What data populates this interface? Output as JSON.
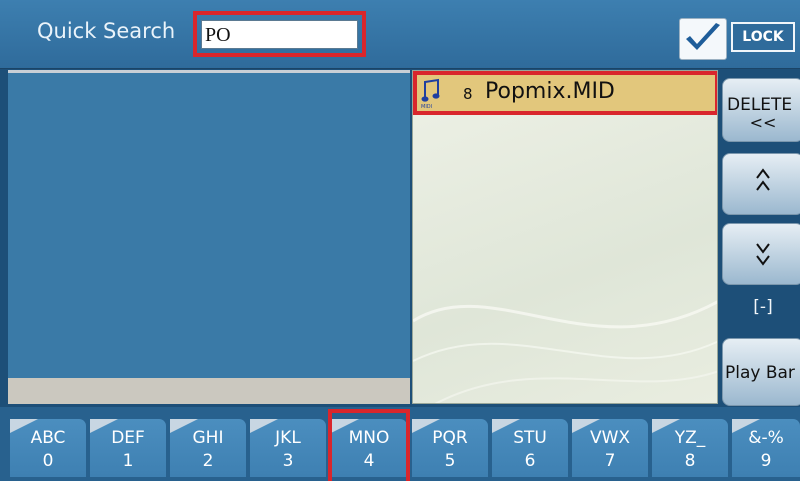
{
  "header": {
    "quick_search_label": "Quick Search",
    "search_value": "PO",
    "lock_checked": true,
    "lock_label": "LOCK"
  },
  "file_list": {
    "items": [
      {
        "number": "8",
        "name": "Popmix.MID",
        "icon": "midi-file-icon",
        "icon_text": "MIDI",
        "selected": true
      }
    ]
  },
  "side_buttons": {
    "delete_label": "DELETE",
    "delete_sub": "<<",
    "up_arrow": "^ ^",
    "down_arrow": "v v",
    "counter": "[-]",
    "play_bar_label": "Play Bar"
  },
  "keys": [
    {
      "letters": "ABC",
      "digit": "0"
    },
    {
      "letters": "DEF",
      "digit": "1"
    },
    {
      "letters": "GHI",
      "digit": "2"
    },
    {
      "letters": "JKL",
      "digit": "3"
    },
    {
      "letters": "MNO",
      "digit": "4",
      "highlighted": true
    },
    {
      "letters": "PQR",
      "digit": "5"
    },
    {
      "letters": "STU",
      "digit": "6"
    },
    {
      "letters": "VWX",
      "digit": "7"
    },
    {
      "letters": "YZ_",
      "digit": "8"
    },
    {
      "letters": "&-%",
      "digit": "9"
    }
  ],
  "colors": {
    "highlight_border": "#d9262c",
    "selected_row": "#e2c77c",
    "panel_blue": "#3a7aa7",
    "key_blue": "#4b8ebf"
  }
}
